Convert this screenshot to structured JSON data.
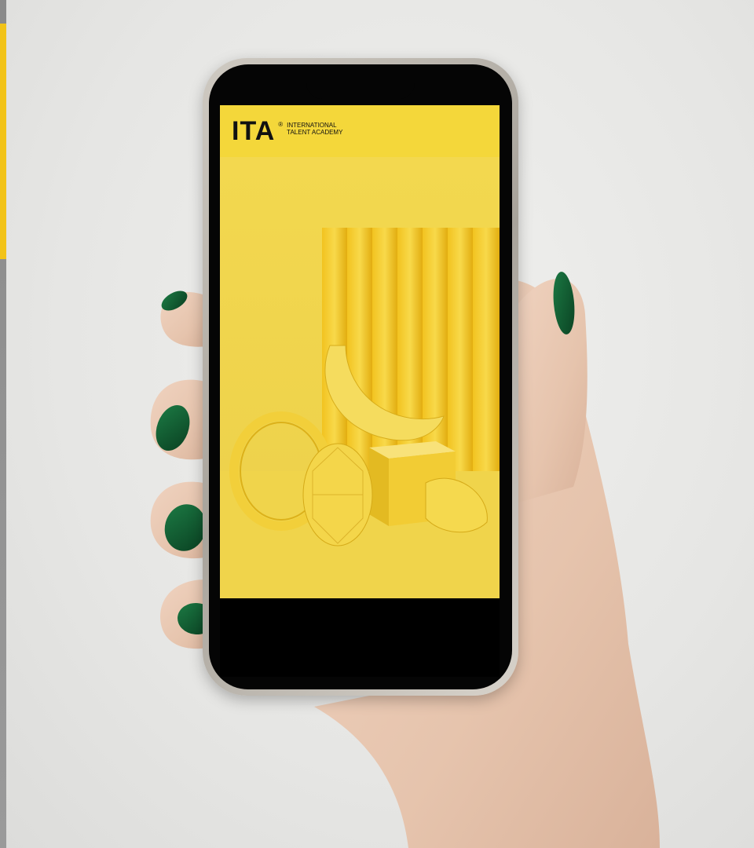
{
  "brand": {
    "logo_text": "ITA",
    "registered_mark": "®",
    "name_line1": "INTERNATIONAL",
    "name_line2": "TALENT ACADEMY"
  },
  "colors": {
    "background": "#e9e9e7",
    "screen_yellow": "#f1d64a",
    "brand_bar_yellow": "#f4d73a",
    "nail_green": "#0f5a2e",
    "skin": "#e8c9b4"
  },
  "icons": {
    "hand": "hand-holding-phone",
    "phone": "smartphone"
  }
}
